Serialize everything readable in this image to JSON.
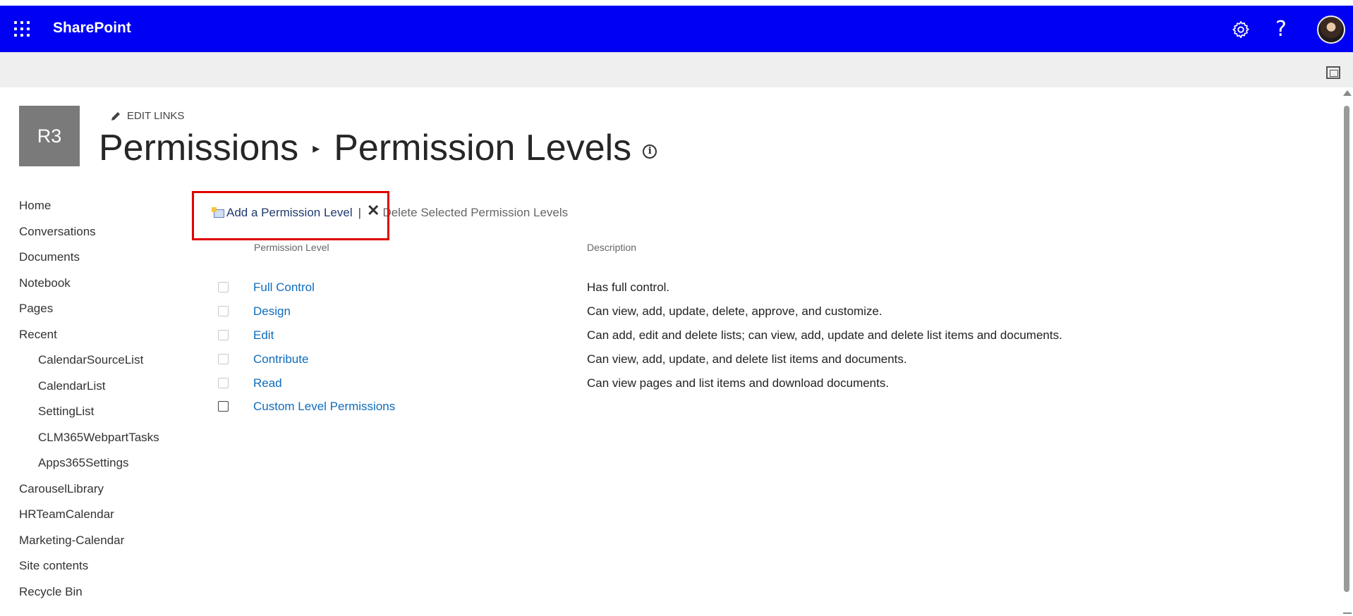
{
  "app": {
    "brand": "SharePoint"
  },
  "icons": {
    "waffle": "waffle-icon",
    "settings": "gear-icon",
    "help": "?",
    "focus": "focus-mode-icon",
    "edit": "pencil-icon",
    "info": "i"
  },
  "site": {
    "logo_text": "R3",
    "edit_links": "EDIT LINKS"
  },
  "title": {
    "parent": "Permissions",
    "separator": "▸",
    "current": "Permission Levels"
  },
  "nav": {
    "items": [
      {
        "label": "Home",
        "sub": false
      },
      {
        "label": "Conversations",
        "sub": false
      },
      {
        "label": "Documents",
        "sub": false
      },
      {
        "label": "Notebook",
        "sub": false
      },
      {
        "label": "Pages",
        "sub": false
      },
      {
        "label": "Recent",
        "sub": false
      },
      {
        "label": "CalendarSourceList",
        "sub": true
      },
      {
        "label": "CalendarList",
        "sub": true
      },
      {
        "label": "SettingList",
        "sub": true
      },
      {
        "label": "CLM365WebpartTasks",
        "sub": true
      },
      {
        "label": "Apps365Settings",
        "sub": true
      },
      {
        "label": "CarouselLibrary",
        "sub": false
      },
      {
        "label": "HRTeamCalendar",
        "sub": false
      },
      {
        "label": "Marketing-Calendar",
        "sub": false
      },
      {
        "label": "Site contents",
        "sub": false
      },
      {
        "label": "Recycle Bin",
        "sub": false
      }
    ]
  },
  "toolbar": {
    "add_label": "Add a Permission Level",
    "separator": "|",
    "delete_label": "Delete Selected Permission Levels",
    "delete_glyph": "✕"
  },
  "table": {
    "headers": {
      "level": "Permission Level",
      "description": "Description"
    },
    "rows": [
      {
        "level": "Full Control",
        "description": "Has full control."
      },
      {
        "level": "Design",
        "description": "Can view, add, update, delete, approve, and customize."
      },
      {
        "level": "Edit",
        "description": "Can add, edit and delete lists; can view, add, update and delete list items and documents."
      },
      {
        "level": "Contribute",
        "description": "Can view, add, update, and delete list items and documents."
      },
      {
        "level": "Read",
        "description": "Can view pages and list items and download documents."
      },
      {
        "level": "Custom Level Permissions",
        "description": ""
      }
    ]
  },
  "colors": {
    "suitebar": "#0000f2",
    "link": "#0f6cbd",
    "highlight": "#e00000"
  }
}
